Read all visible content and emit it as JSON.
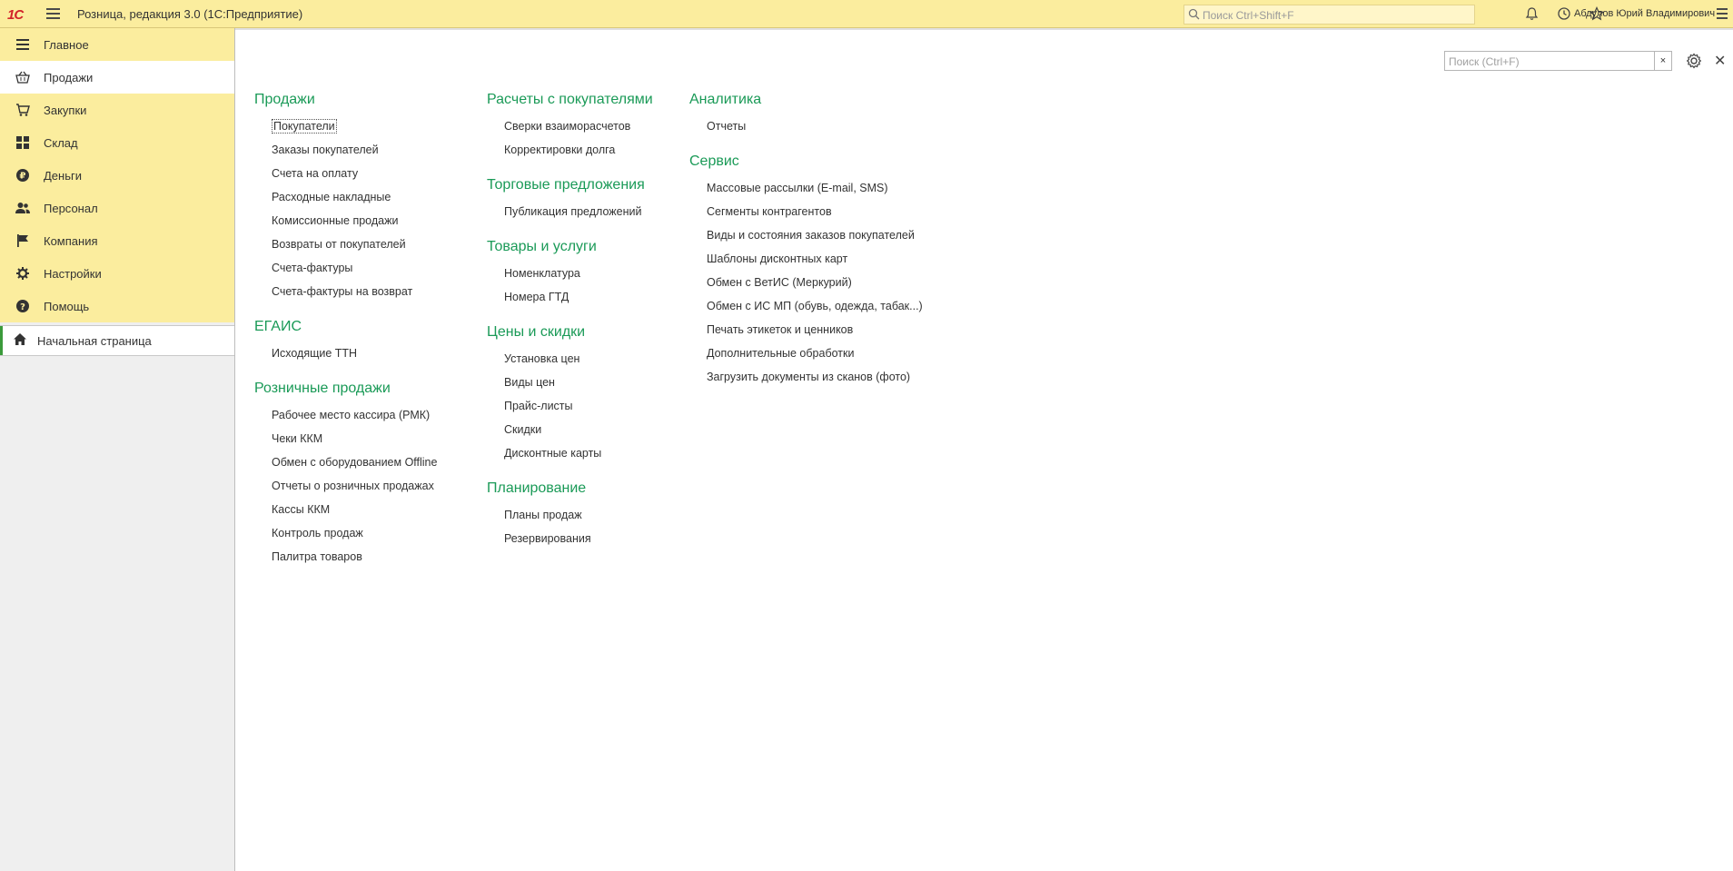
{
  "app": {
    "logo": "1C",
    "title": "Розница, редакция 3.0  (1С:Предприятие)",
    "search_placeholder": "Поиск Ctrl+Shift+F",
    "user": "Абдулов Юрий Владимирович"
  },
  "sidebar": {
    "items": [
      {
        "label": "Главное",
        "icon": "list-icon"
      },
      {
        "label": "Продажи",
        "icon": "basket-icon"
      },
      {
        "label": "Закупки",
        "icon": "cart-icon"
      },
      {
        "label": "Склад",
        "icon": "warehouse-icon"
      },
      {
        "label": "Деньги",
        "icon": "ruble-icon"
      },
      {
        "label": "Персонал",
        "icon": "people-icon"
      },
      {
        "label": "Компания",
        "icon": "flag-icon"
      },
      {
        "label": "Настройки",
        "icon": "gear-icon"
      },
      {
        "label": "Помощь",
        "icon": "help-icon"
      }
    ],
    "active_index": 1,
    "open_pages": [
      {
        "label": "Начальная страница",
        "icon": "home-icon"
      }
    ]
  },
  "form": {
    "search_placeholder": "Поиск (Ctrl+F)",
    "clear_label": "×"
  },
  "columns": [
    {
      "sections": [
        {
          "title": "Продажи",
          "links": [
            "Покупатели",
            "Заказы покупателей",
            "Счета на оплату",
            "Расходные накладные",
            "Комиссионные продажи",
            "Возвраты от покупателей",
            "Счета-фактуры",
            "Счета-фактуры на возврат"
          ]
        },
        {
          "title": "ЕГАИС",
          "links": [
            "Исходящие ТТН"
          ]
        },
        {
          "title": "Розничные продажи",
          "links": [
            "Рабочее место кассира (РМК)",
            "Чеки ККМ",
            "Обмен с оборудованием Offline",
            "Отчеты о розничных продажах",
            "Кассы ККМ",
            "Контроль продаж",
            "Палитра товаров"
          ]
        }
      ]
    },
    {
      "sections": [
        {
          "title": "Расчеты с покупателями",
          "links": [
            "Сверки взаиморасчетов",
            "Корректировки долга"
          ]
        },
        {
          "title": "Торговые предложения",
          "links": [
            "Публикация предложений"
          ]
        },
        {
          "title": "Товары и услуги",
          "links": [
            "Номенклатура",
            "Номера ГТД"
          ]
        },
        {
          "title": "Цены и скидки",
          "links": [
            "Установка цен",
            "Виды цен",
            "Прайс-листы",
            "Скидки",
            "Дисконтные карты"
          ]
        },
        {
          "title": "Планирование",
          "links": [
            "Планы продаж",
            "Резервирования"
          ]
        }
      ]
    },
    {
      "sections": [
        {
          "title": "Аналитика",
          "links": [
            "Отчеты"
          ]
        },
        {
          "title": "Сервис",
          "links": [
            "Массовые рассылки (E-mail, SMS)",
            "Сегменты контрагентов",
            "Виды и состояния заказов покупателей",
            "Шаблоны дисконтных карт",
            "Обмен с ВетИС (Меркурий)",
            "Обмен с ИС МП (обувь, одежда, табак...)",
            "Печать этикеток и ценников",
            "Дополнительные обработки",
            "Загрузить документы из сканов (фото)"
          ]
        }
      ]
    }
  ],
  "colors": {
    "accent_green": "#1a9a57",
    "panel_yellow": "#fbed9e"
  }
}
